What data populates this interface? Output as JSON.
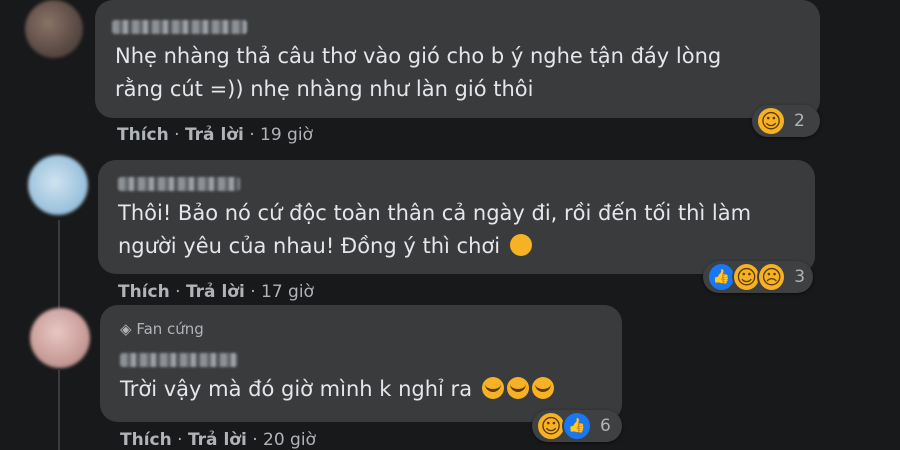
{
  "comments": [
    {
      "text_lines": [
        "Nhẹ nhàng thả câu thơ vào gió cho b ý nghe tận đáy lòng",
        "rằng cút =)) nhẹ nhàng như làn gió thôi"
      ],
      "actions": {
        "like": "Thích",
        "reply": "Trả lời",
        "time": "19 giờ"
      },
      "reactions": {
        "icons": [
          "haha-icon"
        ],
        "count": "2"
      }
    },
    {
      "text_lines": [
        "Thôi! Bảo nó cứ độc toàn thân cả ngày đi, rồi đến tối thì làm",
        "người yêu của nhau! Đồng ý thì chơi"
      ],
      "actions": {
        "like": "Thích",
        "reply": "Trả lời",
        "time": "17 giờ"
      },
      "reactions": {
        "icons": [
          "like-icon",
          "haha-icon",
          "wow-icon"
        ],
        "count": "3"
      }
    },
    {
      "badge": "Fan cứng",
      "text_lines": [
        "Trời vậy mà đó giờ mình k nghỉ ra"
      ],
      "actions": {
        "like": "Thích",
        "reply": "Trả lời",
        "time": "20 giờ"
      },
      "reactions": {
        "icons": [
          "haha-icon",
          "like-icon"
        ],
        "count": "6"
      }
    }
  ],
  "colors": {
    "background": "#18191a",
    "bubble": "#3a3b3c",
    "text": "#e4e6eb",
    "meta": "#b0b3b8",
    "like": "#1877f2",
    "emoji": "#f7b125"
  },
  "separator": "·"
}
